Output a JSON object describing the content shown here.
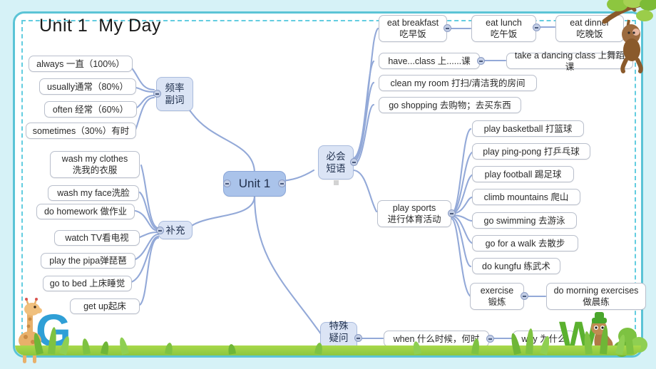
{
  "page": {
    "title": "Unit 1  My Day",
    "center_node": "Unit 1",
    "accent_border": "#5bc4d6",
    "background": "#d6f2f7",
    "node_fill": "#ffffff",
    "branch_fill": "#dbe4f5",
    "center_fill": "#aac3ea",
    "link_color": "#93a9d8"
  },
  "branches": {
    "frequency_adverbs": {
      "label": "频率\n副词",
      "items": [
        {
          "text": "always  一直（100%）"
        },
        {
          "text": "usually通常（80%）"
        },
        {
          "text": "often 经常（60%）"
        },
        {
          "text": "sometimes（30%）有时"
        }
      ]
    },
    "supplement": {
      "label": "补充",
      "items": [
        {
          "text": "wash my clothes\n洗我的衣服"
        },
        {
          "text": "wash my face洗脸"
        },
        {
          "text": "do homework 做作业"
        },
        {
          "text": "watch TV看电视"
        },
        {
          "text": "play the pipa弹琵琶"
        },
        {
          "text": "go to bed 上床睡觉"
        },
        {
          "text": "get  up起床"
        }
      ]
    },
    "must_know_phrases": {
      "label": "必会\n短语",
      "items": [
        {
          "text": "eat breakfast\n吃早饭",
          "children": [
            {
              "text": "eat  lunch\n吃午饭",
              "children": [
                {
                  "text": "eat dinner\n吃晚饭"
                }
              ]
            }
          ]
        },
        {
          "text": "have...class 上......课",
          "children": [
            {
              "text": "take a dancing class 上舞蹈课"
            }
          ]
        },
        {
          "text": "clean my room 打扫/清洁我的房间"
        },
        {
          "text": "go shopping 去购物；去买东西"
        },
        {
          "text": "play sports\n进行体育活动",
          "children": [
            {
              "text": "play  basketball 打篮球"
            },
            {
              "text": "play ping-pong 打乒乓球"
            },
            {
              "text": "play football 踢足球"
            },
            {
              "text": "climb mountains 爬山"
            },
            {
              "text": "go swimming 去游泳"
            },
            {
              "text": "go for a walk 去散步"
            },
            {
              "text": "do kungfu 练武术"
            },
            {
              "text": "exercise\n锻炼",
              "children": [
                {
                  "text": "do morning exercises\n做晨练"
                }
              ]
            }
          ]
        }
      ]
    },
    "question_words": {
      "label": "特殊\n疑问词",
      "items": [
        {
          "text": "when 什么时候，何时",
          "children": [
            {
              "text": "why 为什么"
            }
          ]
        }
      ]
    }
  },
  "decorations": {
    "giraffe_letter": "G",
    "worm_letter": "W",
    "monkey": "monkey-on-branch"
  }
}
